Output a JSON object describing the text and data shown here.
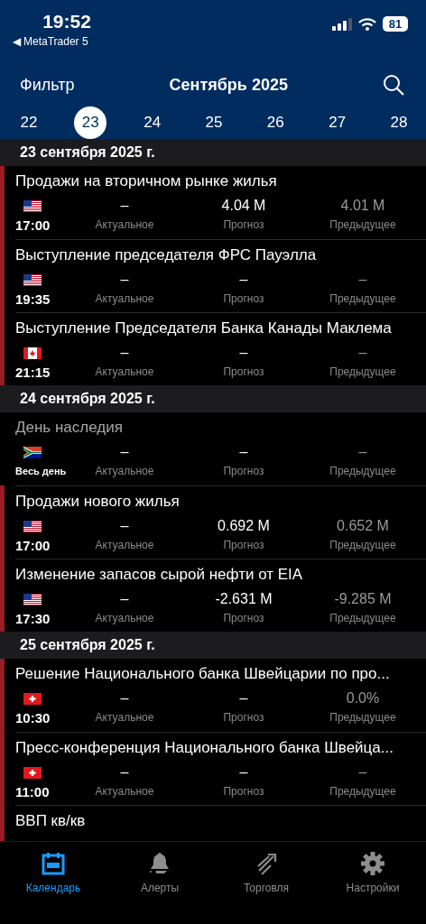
{
  "status_bar": {
    "time": "19:52",
    "back_arrow": "◀",
    "back_app": "MetaTrader 5",
    "battery": "81"
  },
  "header": {
    "filter": "Фильтр",
    "title": "Сентябрь 2025"
  },
  "days": [
    {
      "label": "22",
      "selected": false
    },
    {
      "label": "23",
      "selected": true
    },
    {
      "label": "24",
      "selected": false
    },
    {
      "label": "25",
      "selected": false
    },
    {
      "label": "26",
      "selected": false
    },
    {
      "label": "27",
      "selected": false
    },
    {
      "label": "28",
      "selected": false
    }
  ],
  "sections": [
    {
      "date": "23 сентября 2025 г.",
      "events": [
        {
          "kind": "us",
          "high_importance": true,
          "holiday": false,
          "title": "Продажи на вторичном рынке жилья",
          "time": "17:00",
          "actual": "–",
          "actual_label": "Актуальное",
          "forecast": "4.04 M",
          "forecast_label": "Прогноз",
          "previous": "4.01 M",
          "previous_label": "Предыдущее"
        },
        {
          "kind": "us",
          "high_importance": true,
          "holiday": false,
          "title": "Выступление председателя ФРС Пауэлла",
          "time": "19:35",
          "actual": "–",
          "actual_label": "Актуальное",
          "forecast": "–",
          "forecast_label": "Прогноз",
          "previous": "–",
          "previous_label": "Предыдущее"
        },
        {
          "kind": "ca",
          "high_importance": true,
          "holiday": false,
          "title": "Выступление Председателя Банка Канады Маклема",
          "time": "21:15",
          "actual": "–",
          "actual_label": "Актуальное",
          "forecast": "–",
          "forecast_label": "Прогноз",
          "previous": "–",
          "previous_label": "Предыдущее"
        }
      ]
    },
    {
      "date": "24 сентября 2025 г.",
      "events": [
        {
          "kind": "za",
          "high_importance": false,
          "holiday": true,
          "title": "День наследия",
          "time": "Весь день",
          "actual": "–",
          "actual_label": "Актуальное",
          "forecast": "–",
          "forecast_label": "Прогноз",
          "previous": "–",
          "previous_label": "Предыдущее"
        },
        {
          "kind": "us",
          "high_importance": true,
          "holiday": false,
          "title": "Продажи нового жилья",
          "time": "17:00",
          "actual": "–",
          "actual_label": "Актуальное",
          "forecast": "0.692 M",
          "forecast_label": "Прогноз",
          "previous": "0.652 M",
          "previous_label": "Предыдущее"
        },
        {
          "kind": "us",
          "high_importance": true,
          "holiday": false,
          "title": "Изменение запасов сырой нефти от EIA",
          "time": "17:30",
          "actual": "–",
          "actual_label": "Актуальное",
          "forecast": "-2.631 M",
          "forecast_label": "Прогноз",
          "previous": "-9.285 M",
          "previous_label": "Предыдущее"
        }
      ]
    },
    {
      "date": "25 сентября 2025 г.",
      "events": [
        {
          "kind": "ch",
          "high_importance": true,
          "holiday": false,
          "title": "Решение Национального банка Швейцарии по про...",
          "time": "10:30",
          "actual": "–",
          "actual_label": "Актуальное",
          "forecast": "–",
          "forecast_label": "Прогноз",
          "previous": "0.0%",
          "previous_label": "Предыдущее"
        },
        {
          "kind": "ch",
          "high_importance": true,
          "holiday": false,
          "title": "Пресс-конференция Национального банка Швейца...",
          "time": "11:00",
          "actual": "–",
          "actual_label": "Актуальное",
          "forecast": "–",
          "forecast_label": "Прогноз",
          "previous": "–",
          "previous_label": "Предыдущее"
        },
        {
          "high_importance": true,
          "holiday": false,
          "title": "ВВП кв/кв"
        }
      ]
    }
  ],
  "tabs": [
    {
      "kind": "calendar",
      "label": "Календарь",
      "selected": true
    },
    {
      "kind": "bell",
      "label": "Алерты",
      "selected": false
    },
    {
      "kind": "trade",
      "label": "Торговля",
      "selected": false
    },
    {
      "kind": "gear",
      "label": "Настройки",
      "selected": false
    }
  ]
}
